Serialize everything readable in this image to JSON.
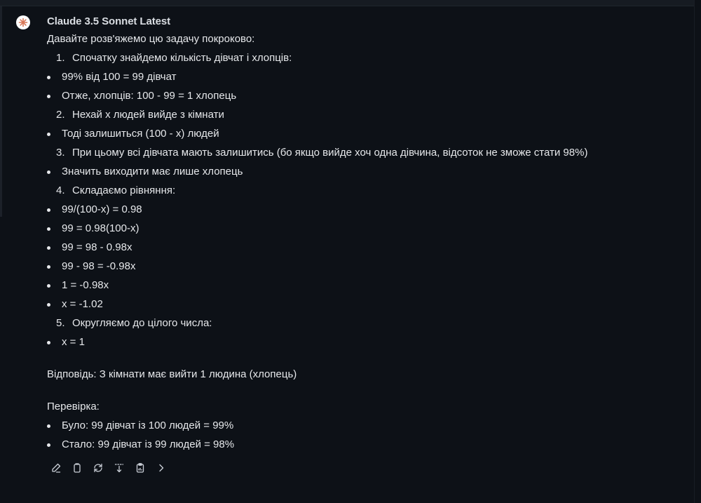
{
  "message": {
    "model_name": "Claude 3.5 Sonnet Latest",
    "intro": "Давайте розв'яжемо цю задачу покроково:",
    "steps": [
      {
        "num": "1.",
        "text": "Спочатку знайдемо кількість дівчат і хлопців:"
      },
      {
        "num": "2.",
        "text": "Нехай x людей вийде з кімнати"
      },
      {
        "num": "3.",
        "text": "При цьому всі дівчата мають залишитись (бо якщо вийде хоч одна дівчина, відсоток не зможе стати 98%)"
      },
      {
        "num": "4.",
        "text": "Складаємо рівняння:"
      },
      {
        "num": "5.",
        "text": "Округляємо до цілого числа:"
      }
    ],
    "bullets": [
      "99% від 100 = 99 дівчат",
      "Отже, хлопців: 100 - 99 = 1 хлопець",
      "Тоді залишиться (100 - x) людей",
      "Значить виходити має лише хлопець",
      "99/(100-x) = 0.98",
      "99 = 0.98(100-x)",
      "99 = 98 - 0.98x",
      "99 - 98 = -0.98x",
      "1 = -0.98x",
      "x = -1.02",
      "x = 1",
      "Було: 99 дівчат із 100 людей = 99%",
      "Стало: 99 дівчат із 99 людей = 98%"
    ],
    "answer": "Відповідь: З кімнати має вийти 1 людина (хлопець)",
    "check_label": "Перевірка:"
  },
  "actions": [
    {
      "icon": "edit-icon"
    },
    {
      "icon": "copy-icon"
    },
    {
      "icon": "regenerate-icon"
    },
    {
      "icon": "branch-icon"
    },
    {
      "icon": "clipboard-icon"
    },
    {
      "icon": "chevron-right-icon"
    }
  ],
  "colors": {
    "background": "#0d1117",
    "text": "#e6e8eb",
    "avatar_accent": "#d97757",
    "icon": "#c9ced6"
  }
}
